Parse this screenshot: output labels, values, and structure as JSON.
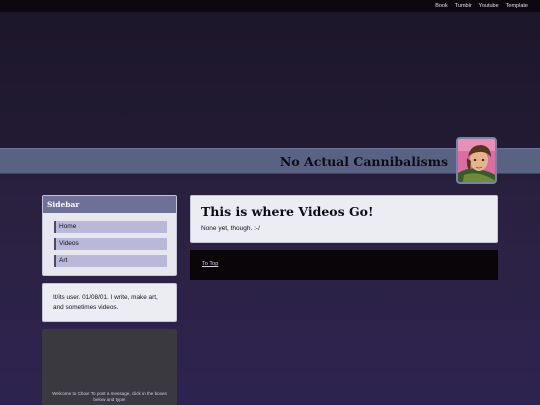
{
  "topnav": {
    "items": [
      "Book",
      "Tumblr",
      "Youtube",
      "Template"
    ]
  },
  "header": {
    "title": "No Actual Cannibalisms"
  },
  "sidebar": {
    "heading": "Sidebar",
    "items": [
      {
        "label": "Home"
      },
      {
        "label": "Videos"
      },
      {
        "label": "Art"
      }
    ]
  },
  "about": {
    "text": "It/its user. 01/08/01. I write, make art, and sometimes videos."
  },
  "chatbox": {
    "text": "Welcome to Cbox! To post a message, click in the boxes below and type!"
  },
  "post": {
    "title": "This is where Videos Go!",
    "body": "None yet, though. :-/"
  },
  "footer": {
    "to_top": "To Top"
  }
}
